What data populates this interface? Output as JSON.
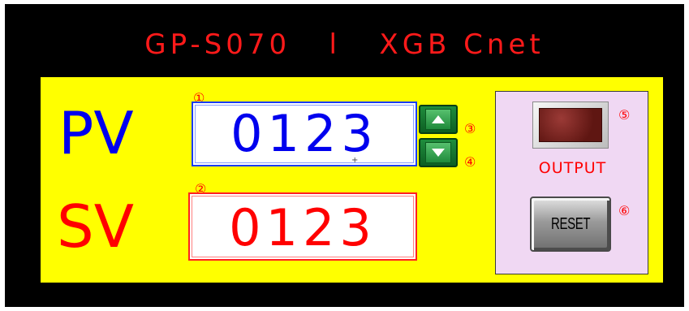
{
  "title": "GP-S070   l   XGB Cnet",
  "pv": {
    "label": "PV",
    "value": "0123",
    "marker": "①"
  },
  "sv": {
    "label": "SV",
    "value": "0123",
    "marker": "②"
  },
  "stepper": {
    "up_icon": "up-arrow-icon",
    "up_marker": "③",
    "down_icon": "down-arrow-icon",
    "down_marker": "④"
  },
  "output": {
    "label": "OUTPUT",
    "marker": "⑤",
    "lamp_state": "off",
    "lamp_color": "#7a1f1b"
  },
  "reset": {
    "label": "RESET",
    "marker": "⑥"
  },
  "colors": {
    "background": "#000000",
    "panel": "#ffff00",
    "side_panel": "#f0d8f3",
    "pv": "#0000ee",
    "sv": "#ff0000",
    "title": "#ff1a1a",
    "stepper": "#1f8a3b"
  }
}
